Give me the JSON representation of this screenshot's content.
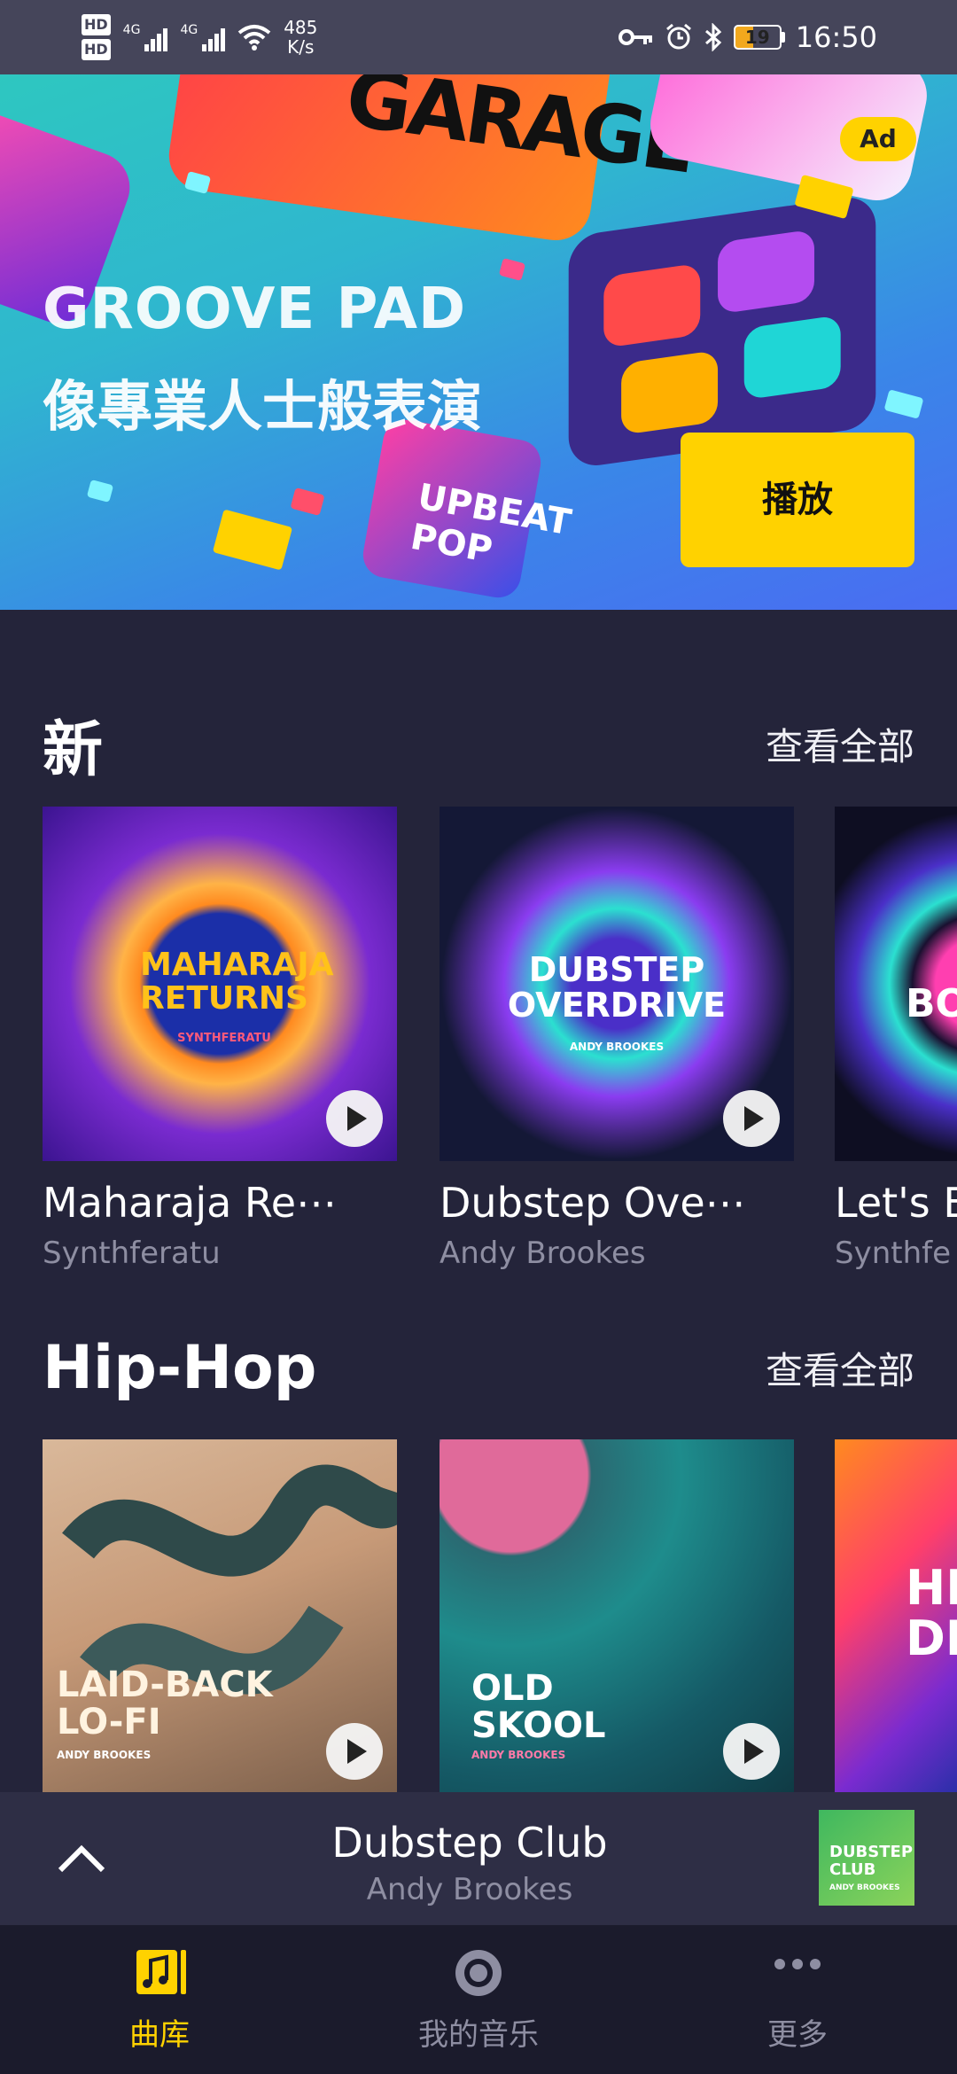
{
  "status_bar": {
    "network_1": "4G",
    "network_2": "4G",
    "speed_value": "485",
    "speed_unit": "K/s",
    "battery": "19",
    "time": "16:50"
  },
  "banner": {
    "ad_badge": "Ad",
    "title": "GROOVE PAD",
    "subtitle": "像專業人士般表演",
    "play_label": "播放",
    "tile_text_1": "GARAGE",
    "tile_text_2": "UPBEAT POP"
  },
  "sections": [
    {
      "title": "新",
      "see_all": "查看全部",
      "items": [
        {
          "title": "Maharaja Re⋯",
          "artist": "Synthferatu",
          "cover_text": "MAHARAJA RETURNS",
          "cover_sub": "SYNTHFERATU"
        },
        {
          "title": "Dubstep Ove⋯",
          "artist": "Andy Brookes",
          "cover_text": "DUBSTEP OVERDRIVE",
          "cover_sub": "ANDY BROOKES"
        },
        {
          "title": "Let's B",
          "artist": "Synthfe",
          "cover_text": "BO"
        }
      ]
    },
    {
      "title": "Hip-Hop",
      "see_all": "查看全部",
      "items": [
        {
          "cover_text": "LAID-BACK LO-FI",
          "cover_sub": "ANDY BROOKES"
        },
        {
          "cover_text": "OLD SKOOL",
          "cover_sub": "ANDY BROOKES"
        },
        {
          "cover_text": "HI DR"
        }
      ]
    }
  ],
  "mini_player": {
    "title": "Dubstep Club",
    "artist": "Andy Brookes",
    "art_text": "DUBSTEP CLUB",
    "art_sub": "ANDY BROOKES"
  },
  "bottom_nav": [
    {
      "label": "曲库",
      "icon": "music-library-icon",
      "active": true
    },
    {
      "label": "我的音乐",
      "icon": "vinyl-disc-icon",
      "active": false
    },
    {
      "label": "更多",
      "icon": "more-dots-icon",
      "active": false
    }
  ],
  "colors": {
    "accent": "#ffd200",
    "background": "#24243a",
    "nav_background": "#1b1b2c",
    "secondary_text": "#8e8ea2"
  }
}
